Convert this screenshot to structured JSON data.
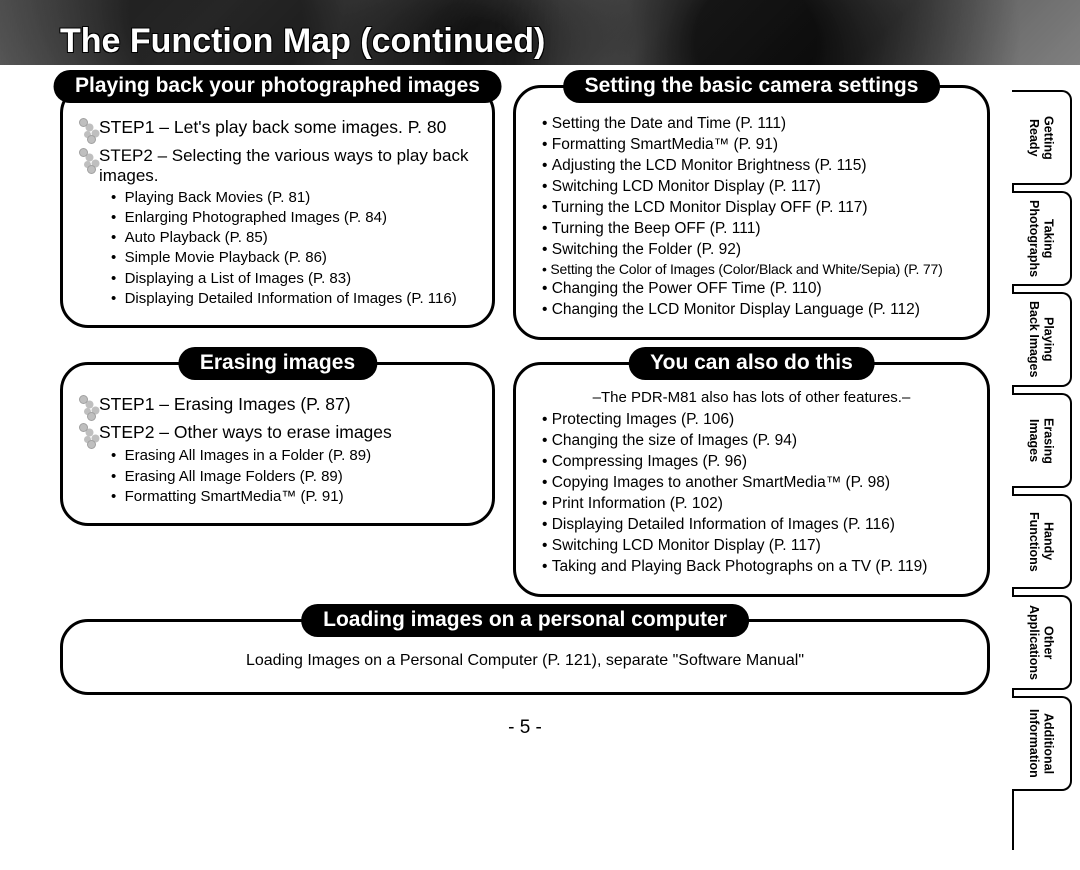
{
  "page": {
    "title": "The Function Map (continued)",
    "number": "- 5 -"
  },
  "playing_back": {
    "title": "Playing back your photographed images",
    "step1": "STEP1 – Let's play back some images. P. 80",
    "step2": "STEP2 – Selecting the various ways to play back images.",
    "items": [
      "Playing Back Movies (P. 81)",
      "Enlarging Photographed Images (P. 84)",
      "Auto Playback (P. 85)",
      "Simple Movie Playback (P. 86)",
      "Displaying a List of Images (P. 83)",
      "Displaying Detailed Information of Images (P. 116)"
    ]
  },
  "settings": {
    "title": "Setting the basic camera settings",
    "items": [
      "Setting the Date and Time (P. 111)",
      "Formatting SmartMedia™ (P. 91)",
      "Adjusting the LCD Monitor Brightness (P. 115)",
      "Switching LCD Monitor Display (P. 117)",
      "Turning the LCD Monitor Display OFF (P. 117)",
      "Turning the Beep OFF (P. 111)",
      "Switching the Folder (P. 92)",
      "Setting the Color of Images (Color/Black and White/Sepia) (P. 77)",
      "Changing the Power OFF Time (P. 110)",
      "Changing the LCD Monitor Display Language (P. 112)"
    ]
  },
  "erasing": {
    "title": "Erasing images",
    "step1": "STEP1 – Erasing Images (P. 87)",
    "step2": "STEP2 – Other ways to erase images",
    "items": [
      "Erasing All Images in a Folder (P. 89)",
      "Erasing All Image Folders (P. 89)",
      "Formatting SmartMedia™ (P. 91)"
    ]
  },
  "also": {
    "title": "You can also do this",
    "subnote": "–The PDR-M81 also has lots of other features.–",
    "items": [
      "Protecting Images (P. 106)",
      "Changing the size of Images (P. 94)",
      "Compressing Images (P. 96)",
      "Copying Images to another SmartMedia™ (P. 98)",
      "Print Information (P. 102)",
      "Displaying Detailed Information of Images (P. 116)",
      "Switching LCD Monitor Display (P. 117)",
      "Taking and Playing Back Photographs on a TV (P. 119)"
    ]
  },
  "loading": {
    "title": "Loading images on a personal computer",
    "body": "Loading Images on a Personal Computer (P. 121), separate \"Software Manual\""
  },
  "tabs": [
    "Getting\nReady",
    "Taking\nPhotographs",
    "Playing\nBack Images",
    "Erasing\nImages",
    "Handy\nFunctions",
    "Other\nApplications",
    "Additional\nInformation"
  ]
}
